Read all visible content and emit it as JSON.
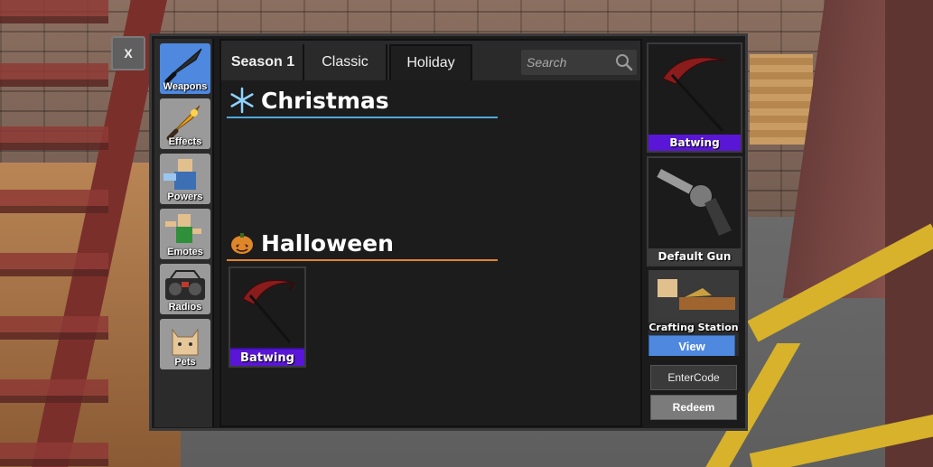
{
  "close_button": {
    "label": "X"
  },
  "categories": [
    {
      "label": "Weapons",
      "icon": "knife-icon",
      "active": true
    },
    {
      "label": "Effects",
      "icon": "flame-knife-icon",
      "active": false
    },
    {
      "label": "Powers",
      "icon": "power-avatar-icon",
      "active": false
    },
    {
      "label": "Emotes",
      "icon": "emote-avatar-icon",
      "active": false
    },
    {
      "label": "Radios",
      "icon": "radio-icon",
      "active": false
    },
    {
      "label": "Pets",
      "icon": "cat-pet-icon",
      "active": false
    }
  ],
  "tabs": [
    {
      "label": "Season 1",
      "active": false
    },
    {
      "label": "Classic",
      "active": false
    },
    {
      "label": "Holiday",
      "active": true
    }
  ],
  "search": {
    "placeholder": "Search",
    "value": ""
  },
  "sections": [
    {
      "title": "Christmas",
      "icon": "snowflake-icon",
      "accent": "#4fa7d8",
      "items": []
    },
    {
      "title": "Halloween",
      "icon": "pumpkin-icon",
      "accent": "#e0862a",
      "items": [
        {
          "name": "Batwing",
          "rarity_color": "#5a16d6"
        }
      ]
    }
  ],
  "equipped": {
    "knife": {
      "name": "Batwing",
      "label_color": "#5a16d6"
    },
    "gun": {
      "name": "Default Gun",
      "label_color": "#3c3c3c"
    }
  },
  "crafting": {
    "title": "Crafting Station",
    "button": "View"
  },
  "code": {
    "placeholder": "EnterCode",
    "redeem_label": "Redeem"
  },
  "colors": {
    "accent_blue": "#4e88df",
    "godly_purple": "#5a16d6",
    "panel_bg": "#1b1b1b"
  }
}
